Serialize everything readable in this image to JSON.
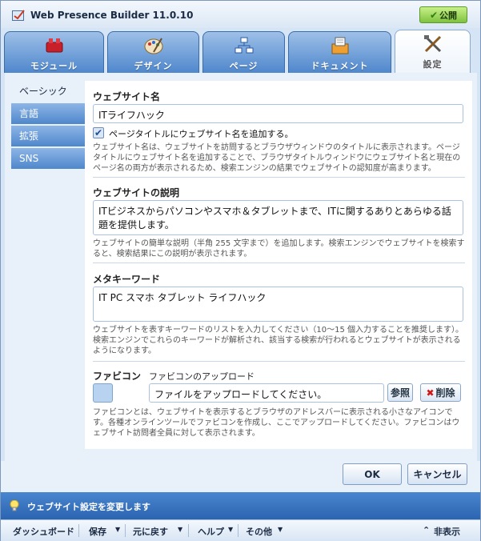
{
  "window": {
    "title": "Web Presence Builder 11.0.10",
    "publish_label": "公開"
  },
  "tabs": [
    {
      "label": "モジュール",
      "icon": "modules-icon"
    },
    {
      "label": "デザイン",
      "icon": "design-icon"
    },
    {
      "label": "ページ",
      "icon": "pages-icon"
    },
    {
      "label": "ドキュメント",
      "icon": "documents-icon"
    },
    {
      "label": "設定",
      "icon": "settings-icon",
      "active": true
    }
  ],
  "sidebar": {
    "items": [
      {
        "label": "ベーシック",
        "active": true
      },
      {
        "label": "言語"
      },
      {
        "label": "拡張"
      },
      {
        "label": "SNS"
      }
    ]
  },
  "settings": {
    "site_name": {
      "title": "ウェブサイト名",
      "value": "ITライフハック",
      "checkbox_label": "ページタイトルにウェブサイト名を追加する。",
      "checkbox_checked": true,
      "description": "ウェブサイト名は、ウェブサイトを訪問するとブラウザウィンドウのタイトルに表示されます。ページタイトルにウェブサイト名を追加することで、ブラウザタイトルウィンドウにウェブサイト名と現在のページ名の両方が表示されるため、検索エンジンの結果でウェブサイトの認知度が高まります。"
    },
    "site_description": {
      "title": "ウェブサイトの説明",
      "value": "ITビジネスからパソコンやスマホ＆タブレットまで、ITに関するありとあらゆる話題を提供します。",
      "description": "ウェブサイトの簡単な説明（半角 255 文字まで）を追加します。検索エンジンでウェブサイトを検索すると、検索結果にこの説明が表示されます。"
    },
    "meta_keywords": {
      "title": "メタキーワード",
      "value": "IT PC スマホ タブレット ライフハック",
      "description": "ウェブサイトを表すキーワードのリストを入力してください（10～15 個入力することを推奨します）。検索エンジンでこれらのキーワードが解析され、該当する検索が行われるとウェブサイトが表示されるようになります。"
    },
    "favicon": {
      "title": "ファビコン",
      "upload_title": "ファビコンのアップロード",
      "placeholder": "ファイルをアップロードしてください。",
      "browse_label": "参照",
      "delete_label": "削除",
      "description": "ファビコンとは、ウェブサイトを表示するとブラウザのアドレスバーに表示される小さなアイコンです。各種オンラインツールでファビコンを作成し、ここでアップロードしてください。ファビコンはウェブサイト訪問者全員に対して表示されます。"
    }
  },
  "buttons": {
    "ok": "OK",
    "cancel": "キャンセル"
  },
  "status": {
    "text": "ウェブサイト設定を変更します",
    "icon": "lightbulb-icon"
  },
  "bottombar": {
    "dashboard": "ダッシュボード",
    "save": "保存",
    "undo": "元に戻す",
    "help": "ヘルプ",
    "other": "その他",
    "hide": "非表示"
  },
  "colors": {
    "accent": "#4f87cc",
    "publish": "#7ec23f",
    "delete": "#d01818"
  }
}
